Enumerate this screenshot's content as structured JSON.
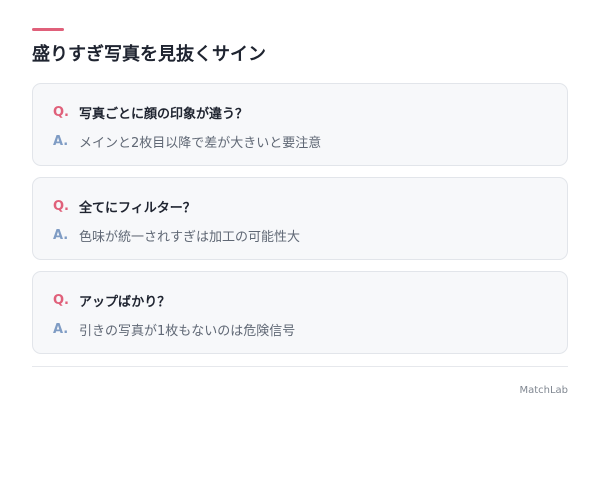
{
  "colors": {
    "accent": "#e0607a",
    "answer_mark": "#7f9cc4",
    "card_background": "#f7f8fa",
    "card_border": "#e2e5ea",
    "title_text": "#1f2430",
    "answer_text": "#606875"
  },
  "header": {
    "title": "盛りすぎ写真を見抜くサイン"
  },
  "qa_items": [
    {
      "q_mark": "Q.",
      "question": "写真ごとに顔の印象が違う？",
      "a_mark": "A.",
      "answer": "メインと2枚目以降で差が大きいと要注意"
    },
    {
      "q_mark": "Q.",
      "question": "全てにフィルター？",
      "a_mark": "A.",
      "answer": "色味が統一されすぎは加工の可能性大"
    },
    {
      "q_mark": "Q.",
      "question": "アップばかり？",
      "a_mark": "A.",
      "answer": "引きの写真が1枚もないのは危険信号"
    }
  ],
  "footer": {
    "brand": "MatchLab"
  }
}
